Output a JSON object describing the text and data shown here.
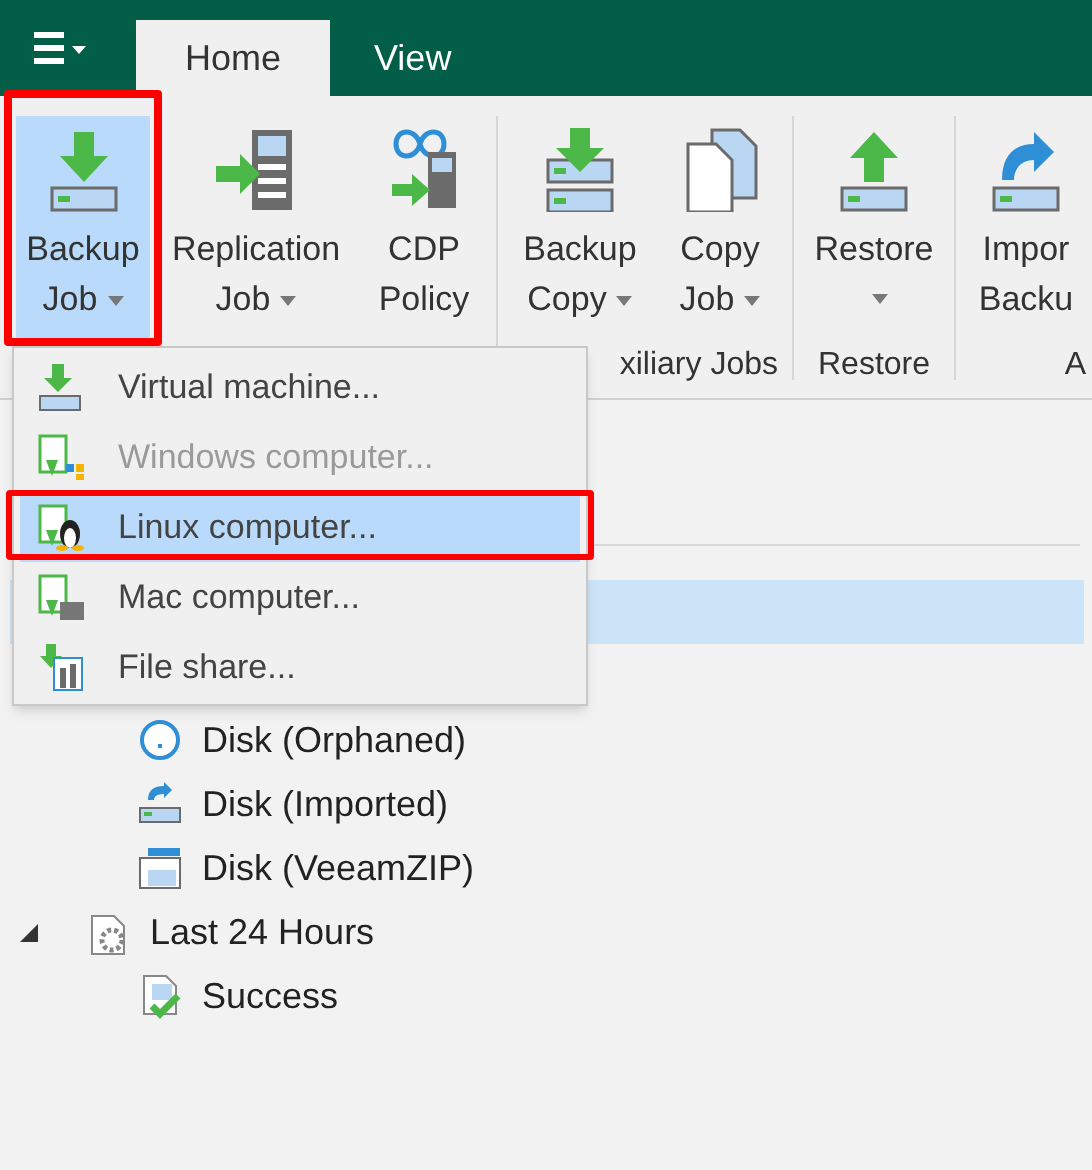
{
  "tabs": [
    {
      "label": "Home",
      "selected": true
    },
    {
      "label": "View",
      "selected": false
    }
  ],
  "ribbon": {
    "groups": [
      {
        "buttons": [
          {
            "lines": [
              "Backup",
              "Job"
            ],
            "dropdown": true,
            "selected": true
          },
          {
            "lines": [
              "Replication",
              "Job"
            ],
            "dropdown": true,
            "selected": false
          },
          {
            "lines": [
              "CDP",
              "Policy"
            ],
            "dropdown": false,
            "selected": false
          }
        ]
      },
      {
        "label": "xiliary Jobs",
        "buttons": [
          {
            "lines": [
              "Backup",
              "Copy"
            ],
            "dropdown": true,
            "selected": false
          },
          {
            "lines": [
              "Copy",
              "Job"
            ],
            "dropdown": true,
            "selected": false
          }
        ]
      },
      {
        "label": "Restore",
        "buttons": [
          {
            "lines": [
              "Restore"
            ],
            "dropdown": true,
            "selected": false
          }
        ]
      },
      {
        "label": "A",
        "buttons": [
          {
            "lines": [
              "Impor",
              "Backu"
            ],
            "dropdown": false,
            "selected": false
          }
        ]
      }
    ]
  },
  "menu": {
    "items": [
      {
        "label": "Virtual machine...",
        "disabled": false,
        "selected": false
      },
      {
        "label": "Windows computer...",
        "disabled": true,
        "selected": false
      },
      {
        "label": "Linux computer...",
        "disabled": false,
        "selected": true
      },
      {
        "label": "Mac computer...",
        "disabled": false,
        "selected": false
      },
      {
        "label": "File share...",
        "disabled": false,
        "selected": false
      }
    ]
  },
  "tree": [
    {
      "selected": true,
      "children": [
        {
          "label": "Disk (Orphaned)",
          "selected": false
        },
        {
          "label": "Disk (Imported)",
          "selected": false
        },
        {
          "label": "Disk (VeeamZIP)",
          "selected": false
        }
      ]
    },
    {
      "label": "Last 24 Hours",
      "selected": false,
      "expanded": true,
      "children": [
        {
          "label": "Success",
          "selected": false
        }
      ]
    }
  ]
}
